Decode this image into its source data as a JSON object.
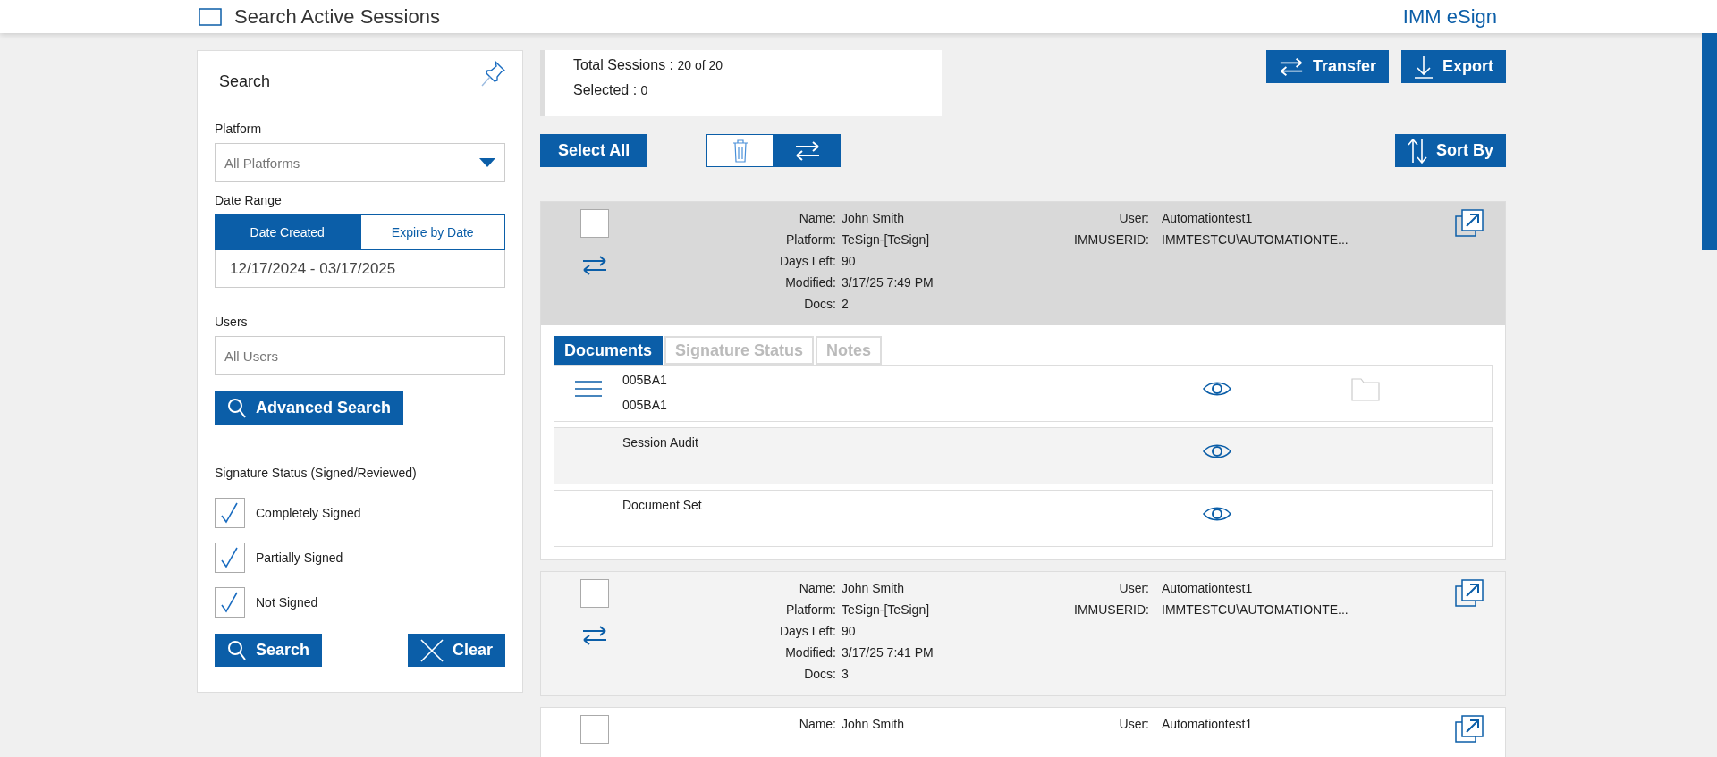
{
  "header": {
    "title": "Search Active Sessions",
    "brand": "IMM eSign"
  },
  "search_panel": {
    "title": "Search",
    "platform": {
      "label": "Platform",
      "value": "All Platforms"
    },
    "date_range": {
      "label": "Date Range",
      "tabs": [
        {
          "label": "Date Created",
          "selected": true
        },
        {
          "label": "Expire by Date",
          "selected": false
        }
      ],
      "value": "12/17/2024 - 03/17/2025"
    },
    "users": {
      "label": "Users",
      "placeholder": "All Users"
    },
    "advanced_search": "Advanced Search",
    "signature_status": {
      "label": "Signature Status (Signed/Reviewed)",
      "options": [
        {
          "label": "Completely Signed",
          "checked": true
        },
        {
          "label": "Partially Signed",
          "checked": true
        },
        {
          "label": "Not Signed",
          "checked": true
        }
      ]
    },
    "search_button": "Search",
    "clear_button": "Clear"
  },
  "summary": {
    "total_label": "Total Sessions : ",
    "total_value": "20 of 20",
    "selected_label": "Selected : ",
    "selected_value": "0"
  },
  "toolbar": {
    "transfer": "Transfer",
    "export": "Export",
    "select_all": "Select All",
    "sort_by": "Sort By",
    "toggle": [
      {
        "kind": "delete",
        "selected": false
      },
      {
        "kind": "transfer",
        "selected": true
      }
    ]
  },
  "sessions": [
    {
      "checked": false,
      "expanded": true,
      "left_fields": [
        {
          "label": "Name:",
          "value": "John Smith"
        },
        {
          "label": "Platform:",
          "value": "TeSign-[TeSign]"
        },
        {
          "label": "Days Left:",
          "value": "90"
        },
        {
          "label": "Modified:",
          "value": "3/17/25 7:49 PM"
        },
        {
          "label": "Docs:",
          "value": "2"
        }
      ],
      "right_fields": [
        {
          "label": "User:",
          "value": "Automationtest1"
        },
        {
          "label": "IMMUSERID:",
          "value": "IMMTESTCU\\AUTOMATIONTE..."
        }
      ],
      "tabs": [
        {
          "label": "Documents",
          "selected": true
        },
        {
          "label": "Signature Status",
          "selected": false
        },
        {
          "label": "Notes",
          "selected": false
        }
      ],
      "documents": [
        {
          "kind": "document",
          "lines": [
            "005BA1",
            "005BA1"
          ]
        },
        {
          "kind": "audit",
          "lines": [
            "Session Audit"
          ]
        },
        {
          "kind": "set",
          "lines": [
            "Document Set"
          ]
        }
      ]
    },
    {
      "checked": false,
      "expanded": false,
      "left_fields": [
        {
          "label": "Name:",
          "value": "John Smith"
        },
        {
          "label": "Platform:",
          "value": "TeSign-[TeSign]"
        },
        {
          "label": "Days Left:",
          "value": "90"
        },
        {
          "label": "Modified:",
          "value": "3/17/25 7:41 PM"
        },
        {
          "label": "Docs:",
          "value": "3"
        }
      ],
      "right_fields": [
        {
          "label": "User:",
          "value": "Automationtest1"
        },
        {
          "label": "IMMUSERID:",
          "value": "IMMTESTCU\\AUTOMATIONTE..."
        }
      ]
    },
    {
      "checked": false,
      "expanded": false,
      "left_fields": [
        {
          "label": "Name:",
          "value": "John Smith"
        }
      ],
      "right_fields": [
        {
          "label": "User:",
          "value": "Automationtest1"
        }
      ]
    }
  ]
}
